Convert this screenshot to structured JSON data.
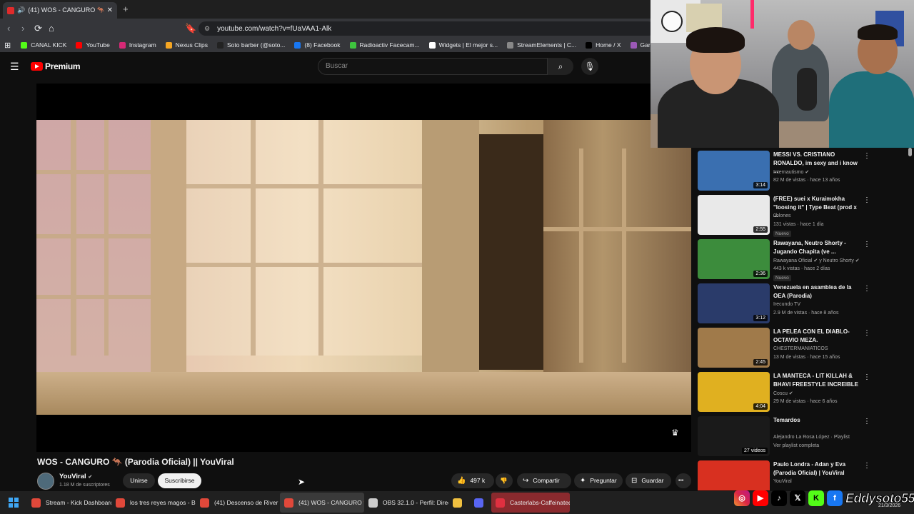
{
  "browser": {
    "tab_title": "(41) WOS - CANGURO 🦘 (Pa",
    "new_tab": "+",
    "url": "youtube.com/watch?v=fUaVAA1-Alk",
    "bookmarks": [
      {
        "label": "CANAL KICK",
        "color": "#53fc18"
      },
      {
        "label": "YouTube",
        "color": "#ff0000"
      },
      {
        "label": "Instagram",
        "color": "#d62976"
      },
      {
        "label": "Nexus Clips",
        "color": "#f5a623"
      },
      {
        "label": "Soto barber (@soto...",
        "color": "#222222"
      },
      {
        "label": "(8) Facebook",
        "color": "#1877f2"
      },
      {
        "label": "Radioactiv Facecam...",
        "color": "#3ec43e"
      },
      {
        "label": "Widgets | El mejor s...",
        "color": "#ffffff"
      },
      {
        "label": "StreamElements | C...",
        "color": "#888888"
      },
      {
        "label": "Home / X",
        "color": "#000000"
      },
      {
        "label": "Gartic Phone - Tele",
        "color": "#9b59b6"
      }
    ]
  },
  "youtube": {
    "logo_text": "Premium",
    "search_placeholder": "Buscar",
    "video_title": "WOS - CANGURO 🦘 (Parodia Oficial) || YouViral",
    "channel_name": "YouViral",
    "channel_verified": "✔",
    "subscribers": "1.18 M de suscriptores",
    "join_label": "Unirse",
    "subscribe_label": "Suscribirse",
    "likes": "497 k",
    "share_label": "Compartir",
    "ask_label": "Preguntar",
    "save_label": "Guardar",
    "more_label": "•••"
  },
  "recommendations": [
    {
      "title": "MESSI VS. CRISTIANO RONALDO, im sexy and i know ...",
      "channel": "Internautismo",
      "verified": true,
      "meta": "82 M de vistas · hace 13 años",
      "duration": "3:14",
      "badge": "",
      "thumb": "#3a6fb0"
    },
    {
      "title": "(FREE) suei x Kuraimokha \"loosing it\" | Type Beat (prod x ...",
      "channel": "0blones",
      "verified": false,
      "meta": "131 vistas · hace 1 día",
      "duration": "2:55",
      "badge": "Nuevo",
      "thumb": "#e9e9e9"
    },
    {
      "title": "Rawayana, Neutro Shorty - Jugando Chapita (ve ...",
      "channel": "Rawayana Oficial ✔ y Neutro Shorty ✔",
      "verified": false,
      "meta": "443 k vistas · hace 2 días",
      "duration": "2:36",
      "badge": "Nuevo",
      "thumb": "#3c8c3c"
    },
    {
      "title": "Venezuela en asamblea de la OEA (Parodia)",
      "channel": "Irecundo TV",
      "verified": false,
      "meta": "2.9 M de vistas · hace 8 años",
      "duration": "3:12",
      "badge": "",
      "thumb": "#2a3b6a"
    },
    {
      "title": "LA PELEA CON EL DIABLO- OCTAVIO MEZA.",
      "channel": "CHESTERMANIATICOS",
      "verified": false,
      "meta": "13 M de vistas · hace 15 años",
      "duration": "2:45",
      "badge": "",
      "thumb": "#a07a4a"
    },
    {
      "title": "LA MANTECA - LIT KILLAH & BHAVI FREESTYLE INCREIBLE",
      "channel": "Coscu",
      "verified": true,
      "meta": "29 M de vistas · hace 6 años",
      "duration": "4:04",
      "badge": "",
      "thumb": "#e0b020"
    },
    {
      "title": "Temardos",
      "channel": "Alejandro La Rosa López · Playlist",
      "verified": false,
      "meta": "Ver playlist completa",
      "duration": "27 videos",
      "badge": "",
      "thumb": "#1a1a1a"
    },
    {
      "title": "Paulo Londra - Adan y Eva (Parodia Oficial) | YouViral",
      "channel": "YouViral",
      "verified": false,
      "meta": "",
      "duration": "",
      "badge": "",
      "thumb": "#d83020"
    }
  ],
  "taskbar": [
    {
      "label": "Stream - Kick Dashboard",
      "color": "#e0483a"
    },
    {
      "label": "los tres reyes magos - B",
      "color": "#e0483a"
    },
    {
      "label": "(41) Descenso de River 2",
      "color": "#e0483a"
    },
    {
      "label": "(41) WOS - CANGURO 🦘",
      "color": "#e0483a"
    },
    {
      "label": "OBS 32.1.0 - Perfil: Direc",
      "color": "#cccccc"
    },
    {
      "label": "",
      "color": "#f0c040"
    },
    {
      "label": "",
      "color": "#5865f2"
    },
    {
      "label": "Casterlabs-Caffeinated",
      "color": "#e03040"
    }
  ],
  "overlay": {
    "handle": "Eddysoto55",
    "date": "21/3/2026"
  }
}
